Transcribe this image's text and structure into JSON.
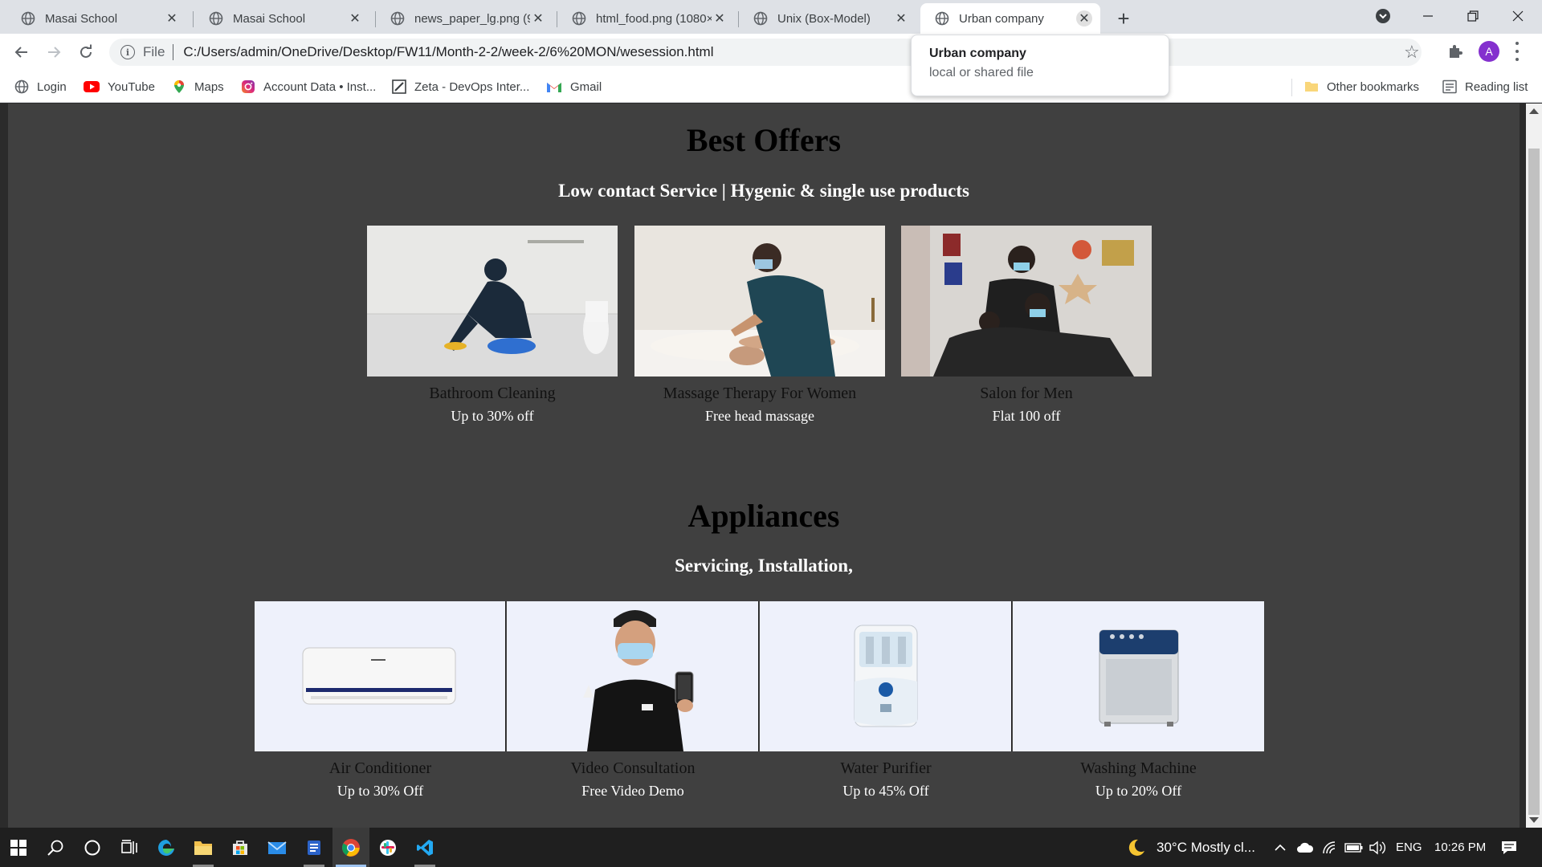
{
  "browser": {
    "tabs": [
      {
        "title": "Masai School",
        "active": false
      },
      {
        "title": "Masai School",
        "active": false
      },
      {
        "title": "news_paper_lg.png (9",
        "active": false
      },
      {
        "title": "html_food.png (1080×",
        "active": false
      },
      {
        "title": "Unix (Box-Model)",
        "active": false
      },
      {
        "title": "Urban company",
        "active": true
      }
    ],
    "new_tab_symbol": "+",
    "omnibox": {
      "scheme_chip": "File",
      "url": "C:/Users/admin/OneDrive/Desktop/FW11/Month-2-2/week-2/6%20MON/wesession.html"
    },
    "profile_initial": "A",
    "tooltip": {
      "title": "Urban company",
      "subtitle": "local or shared file"
    },
    "bookmarks": [
      {
        "label": "Login",
        "icon": "globe-icon"
      },
      {
        "label": "YouTube",
        "icon": "youtube-icon"
      },
      {
        "label": "Maps",
        "icon": "maps-icon"
      },
      {
        "label": "Account Data • Inst...",
        "icon": "instagram-icon"
      },
      {
        "label": "Zeta - DevOps Inter...",
        "icon": "zeta-icon"
      },
      {
        "label": "Gmail",
        "icon": "gmail-icon"
      }
    ],
    "other_bookmarks": "Other bookmarks",
    "reading_list": "Reading list"
  },
  "page": {
    "best_offers": {
      "title": "Best Offers",
      "subtitle": "Low contact Service | Hygenic & single use products",
      "cards": [
        {
          "name": "Bathroom Cleaning",
          "offer": "Up to 30% off"
        },
        {
          "name": "Massage Therapy For Women",
          "offer": "Free head massage"
        },
        {
          "name": "Salon for Men",
          "offer": "Flat 100 off"
        }
      ]
    },
    "appliances": {
      "title": "Appliances",
      "subtitle": "Servicing, Installation,",
      "cards": [
        {
          "name": "Air Conditioner",
          "offer": "Up to 30% Off"
        },
        {
          "name": "Video Consultation",
          "offer": "Free Video Demo"
        },
        {
          "name": "Water Purifier",
          "offer": "Up to 45% Off"
        },
        {
          "name": "Washing Machine",
          "offer": "Up to 20% Off"
        }
      ]
    }
  },
  "taskbar": {
    "weather": "30°C  Mostly cl...",
    "language": "ENG",
    "time": "10:26 PM"
  },
  "colors": {
    "page_bg": "#404040",
    "tab_strip": "#dee1e6",
    "avatar": "#8430ce",
    "taskbar": "#1f1f1f"
  }
}
